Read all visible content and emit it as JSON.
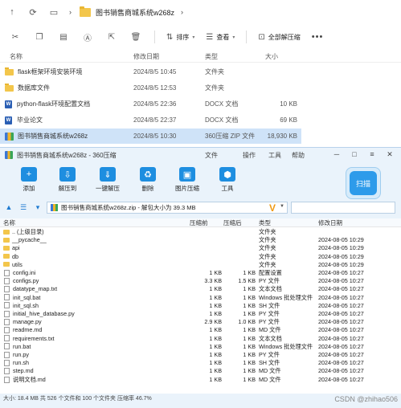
{
  "explorer": {
    "breadcrumb": "图书销售商城系统w268z",
    "toolbar": {
      "sort": "排序",
      "view": "查看",
      "extract_all": "全部解压缩"
    },
    "columns": {
      "name": "名称",
      "date": "修改日期",
      "type": "类型",
      "size": "大小"
    },
    "rows": [
      {
        "name": "flask框架环境安装环境",
        "date": "2024/8/5 10:45",
        "type": "文件夹",
        "size": "",
        "icon": "folder"
      },
      {
        "name": "数据库文件",
        "date": "2024/8/5 12:53",
        "type": "文件夹",
        "size": "",
        "icon": "folder"
      },
      {
        "name": "python-flask环境配置文档",
        "date": "2024/8/5 22:36",
        "type": "DOCX 文档",
        "size": "10 KB",
        "icon": "docx"
      },
      {
        "name": "毕业论文",
        "date": "2024/8/5 22:37",
        "type": "DOCX 文档",
        "size": "69 KB",
        "icon": "docx"
      },
      {
        "name": "图书销售商城系统w268z",
        "date": "2024/8/5 10:30",
        "type": "360压缩 ZIP 文件",
        "size": "18,930 KB",
        "icon": "zip",
        "selected": true
      }
    ]
  },
  "zipwin": {
    "title": "图书销售商城系统w268z - 360压缩",
    "menu": [
      "文件",
      "操作",
      "工具",
      "帮助"
    ],
    "tools": [
      "添加",
      "解压到",
      "一键解压",
      "删除",
      "图片压缩",
      "工具"
    ],
    "scan_label": "扫描",
    "address": "图书销售商城系统w268z.zip - 解包大小为 39.3 MB",
    "columns": {
      "name": "名称",
      "size": "压缩前",
      "psize": "压缩后",
      "type": "类型",
      "date": "修改日期"
    },
    "rows": [
      {
        "name": ".. (上级目录)",
        "size": "",
        "psize": "",
        "type": "文件夹",
        "date": "",
        "icon": "up"
      },
      {
        "name": "__pycache__",
        "size": "",
        "psize": "",
        "type": "文件夹",
        "date": "2024-08-05 10:29",
        "icon": "folder"
      },
      {
        "name": "api",
        "size": "",
        "psize": "",
        "type": "文件夹",
        "date": "2024-08-05 10:29",
        "icon": "folder"
      },
      {
        "name": "db",
        "size": "",
        "psize": "",
        "type": "文件夹",
        "date": "2024-08-05 10:29",
        "icon": "folder"
      },
      {
        "name": "utils",
        "size": "",
        "psize": "",
        "type": "文件夹",
        "date": "2024-08-05 10:29",
        "icon": "folder"
      },
      {
        "name": "config.ini",
        "size": "1 KB",
        "psize": "1 KB",
        "type": "配置设置",
        "date": "2024-08-05 10:27",
        "icon": "file"
      },
      {
        "name": "configs.py",
        "size": "3.3 KB",
        "psize": "1.5 KB",
        "type": "PY 文件",
        "date": "2024-08-05 10:27",
        "icon": "file"
      },
      {
        "name": "datatype_map.txt",
        "size": "1 KB",
        "psize": "1 KB",
        "type": "文本文档",
        "date": "2024-08-05 10:27",
        "icon": "file"
      },
      {
        "name": "init_sql.bat",
        "size": "1 KB",
        "psize": "1 KB",
        "type": "Windows 批处理文件",
        "date": "2024-08-05 10:27",
        "icon": "file"
      },
      {
        "name": "init_sql.sh",
        "size": "1 KB",
        "psize": "1 KB",
        "type": "SH 文件",
        "date": "2024-08-05 10:27",
        "icon": "file"
      },
      {
        "name": "initial_hive_database.py",
        "size": "1 KB",
        "psize": "1 KB",
        "type": "PY 文件",
        "date": "2024-08-05 10:27",
        "icon": "file"
      },
      {
        "name": "manage.py",
        "size": "2.9 KB",
        "psize": "1.0 KB",
        "type": "PY 文件",
        "date": "2024-08-05 10:27",
        "icon": "file"
      },
      {
        "name": "readme.md",
        "size": "1 KB",
        "psize": "1 KB",
        "type": "MD 文件",
        "date": "2024-08-05 10:27",
        "icon": "file"
      },
      {
        "name": "requirements.txt",
        "size": "1 KB",
        "psize": "1 KB",
        "type": "文本文档",
        "date": "2024-08-05 10:27",
        "icon": "file"
      },
      {
        "name": "run.bat",
        "size": "1 KB",
        "psize": "1 KB",
        "type": "Windows 批处理文件",
        "date": "2024-08-05 10:27",
        "icon": "file"
      },
      {
        "name": "run.py",
        "size": "1 KB",
        "psize": "1 KB",
        "type": "PY 文件",
        "date": "2024-08-05 10:27",
        "icon": "file"
      },
      {
        "name": "run.sh",
        "size": "1 KB",
        "psize": "1 KB",
        "type": "SH 文件",
        "date": "2024-08-05 10:27",
        "icon": "file"
      },
      {
        "name": "step.md",
        "size": "1 KB",
        "psize": "1 KB",
        "type": "MD 文件",
        "date": "2024-08-05 10:27",
        "icon": "file"
      },
      {
        "name": "说明文档.md",
        "size": "1 KB",
        "psize": "1 KB",
        "type": "MD 文件",
        "date": "2024-08-05 10:27",
        "icon": "file"
      }
    ],
    "status": "大小: 18.4 MB 共 526 个文件和 100 个文件夹 压缩率 46.7%"
  },
  "watermark": "CSDN @zhihao506"
}
